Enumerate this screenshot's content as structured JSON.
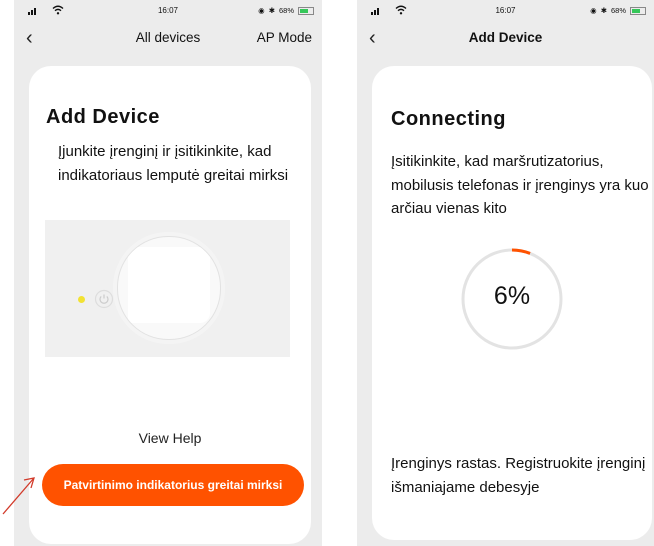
{
  "left": {
    "status": {
      "time": "16:07",
      "battery": "68%"
    },
    "nav": {
      "back_icon": "‹",
      "title": "All devices",
      "action": "AP Mode"
    },
    "card": {
      "title": "Add Device",
      "instruction": "Įjunkite įrenginį ir įsitikinkite, kad indikatoriaus lemputė greitai mirksi",
      "illustration_icons": [
        "device-circle-icon",
        "led-icon",
        "power-icon"
      ],
      "help": "View Help",
      "confirm": "Patvirtinimo indikatorius greitai mirksi"
    }
  },
  "right": {
    "status": {
      "time": "16:07",
      "battery": "68%"
    },
    "nav": {
      "back_icon": "‹",
      "title": "Add Device"
    },
    "card": {
      "title": "Connecting",
      "tip": "Įsitikinkite, kad maršrutizatorius, mobilusis telefonas ir įrenginys yra kuo arčiau vienas kito",
      "progress_value": 6,
      "progress_label": "6%",
      "status": "Įrenginys rastas. Registruokite įrenginį išmaniajame debesyje"
    }
  },
  "colors": {
    "accent": "#ff5200",
    "led": "#f2e233",
    "progress_track": "#e3e3e3",
    "battery": "#35c759"
  }
}
